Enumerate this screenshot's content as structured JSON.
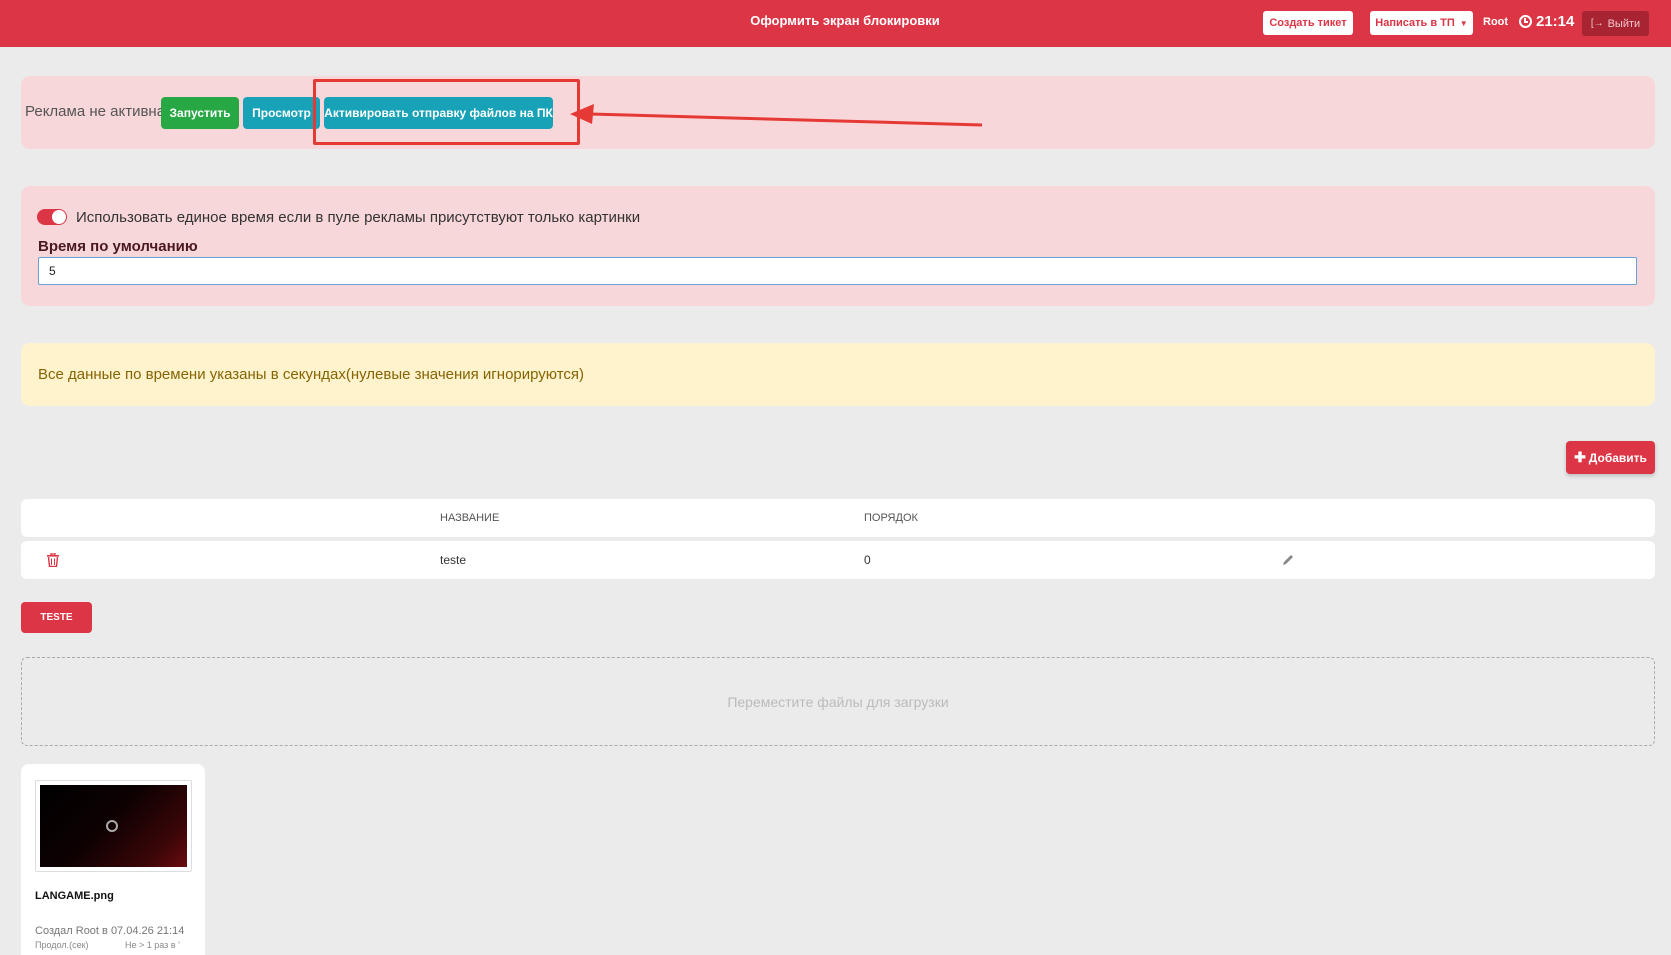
{
  "header": {
    "title": "Оформить экран блокировки",
    "create_ticket": "Создать тикет",
    "write_support": "Написать в ТП",
    "user": "Root",
    "time": "21:14",
    "logout": "Выйти"
  },
  "ad": {
    "status": "Реклама не активна",
    "start": "Запустить",
    "preview": "Просмотр",
    "activate": "Активировать отправку файлов на ПК"
  },
  "settings": {
    "toggle_label": "Использовать единое время если в пуле рекламы присутствуют только картинки",
    "toggle_on": true,
    "default_time_label": "Время по умолчанию",
    "default_time_value": "5"
  },
  "info": {
    "text": "Все данные по времени указаны в секундах(нулевые значения игнорируются)"
  },
  "toolbar": {
    "add": "Добавить"
  },
  "table": {
    "columns": [
      "НАЗВАНИЕ",
      "ПОРЯДОК"
    ],
    "rows": [
      {
        "name": "teste",
        "order": "0"
      }
    ]
  },
  "tag": "TESTE",
  "dropzone": "Переместите файлы для загрузки",
  "file_card": {
    "name": "LANGAME.png",
    "created": "Создал Root в 07.04.26 21:14",
    "duration_label": "Продол.(сек)",
    "rule": "Не > 1 раз в '"
  },
  "colors": {
    "primary": "#dc3545",
    "success": "#28a745",
    "info": "#17a2b8",
    "panel_pink": "#f8d7da",
    "panel_yellow": "#fff3cd",
    "highlight": "#e53935"
  },
  "icons": {
    "clock": "clock-icon",
    "logout": "logout-icon",
    "plus": "plus-icon",
    "trash": "trash-icon",
    "edit": "pencil-icon"
  }
}
